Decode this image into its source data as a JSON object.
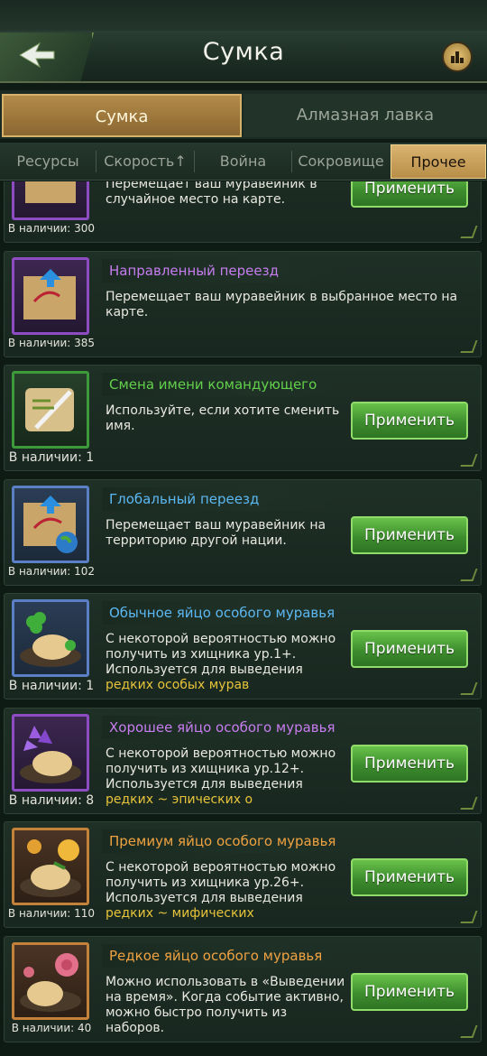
{
  "header": {
    "title": "Сумка"
  },
  "main_tabs": [
    {
      "label": "Сумка",
      "active": true
    },
    {
      "label": "Алмазная лавка",
      "active": false
    }
  ],
  "sub_tabs": [
    {
      "label": "Ресурсы"
    },
    {
      "label": "Скорость↑"
    },
    {
      "label": "Война"
    },
    {
      "label": "Сокровище"
    },
    {
      "label": "Прочее",
      "active": true
    }
  ],
  "apply_label": "Применить",
  "items": [
    {
      "name": "",
      "desc": "Перемещает ваш муравейник в случайное место на карте.",
      "stock": "В наличии: 300",
      "icon": "map-icon",
      "frame": "purple"
    },
    {
      "name": "Направленный переезд",
      "desc": "Перемещает ваш муравейник в выбранное место на карте.",
      "stock": "В наличии: 385",
      "icon": "targeted-relocation-map-icon",
      "frame": "purple"
    },
    {
      "name": "Смена имени командующего",
      "desc": "Используйте, если хотите сменить имя.",
      "stock": "В наличии: 1",
      "icon": "scroll-quill-icon",
      "frame": "green"
    },
    {
      "name": "Глобальный переезд",
      "desc": "Перемещает ваш муравейник на территорию другой нации.",
      "stock": "В наличии: 102",
      "icon": "global-relocation-map-icon",
      "frame": "blue"
    },
    {
      "name": "Обычное яйцо особого муравья",
      "desc": "С некоторой вероятностью можно получить из хищника ур.1+. Используется для выведения ",
      "desc_hl": "редких особых мурав",
      "stock": "В наличии: 1",
      "icon": "clover-egg-icon",
      "frame": "blue"
    },
    {
      "name": "Хорошее яйцо особого муравья",
      "desc": "С некоторой вероятностью можно получить из хищника ур.12+. Используется для выведения ",
      "desc_hl": "редких ~ эпических о",
      "stock": "В наличии: 8",
      "icon": "violet-egg-icon",
      "frame": "purple"
    },
    {
      "name": "Премиум яйцо особого муравья",
      "desc": "С некоторой вероятностью можно получить из хищника ур.26+. Используется для выведения ",
      "desc_hl": "редких ~ мифических",
      "stock": "В наличии: 110",
      "icon": "rose-egg-icon",
      "frame": "orange"
    },
    {
      "name": "Редкое яйцо особого муравья",
      "desc": "Можно использовать в «Выведении на время». Когда событие активно, можно быстро получить из наборов.",
      "stock": "В наличии: 40",
      "icon": "pink-flower-egg-icon",
      "frame": "orange"
    }
  ],
  "colors": {
    "accent_gold": "#d9b470",
    "apply_green": "#4fa83a",
    "name_purple": "#c77cf0",
    "name_green": "#62d04a",
    "name_blue": "#5cb8f2",
    "name_orange": "#f0a240",
    "highlight": "#e6c33a"
  }
}
